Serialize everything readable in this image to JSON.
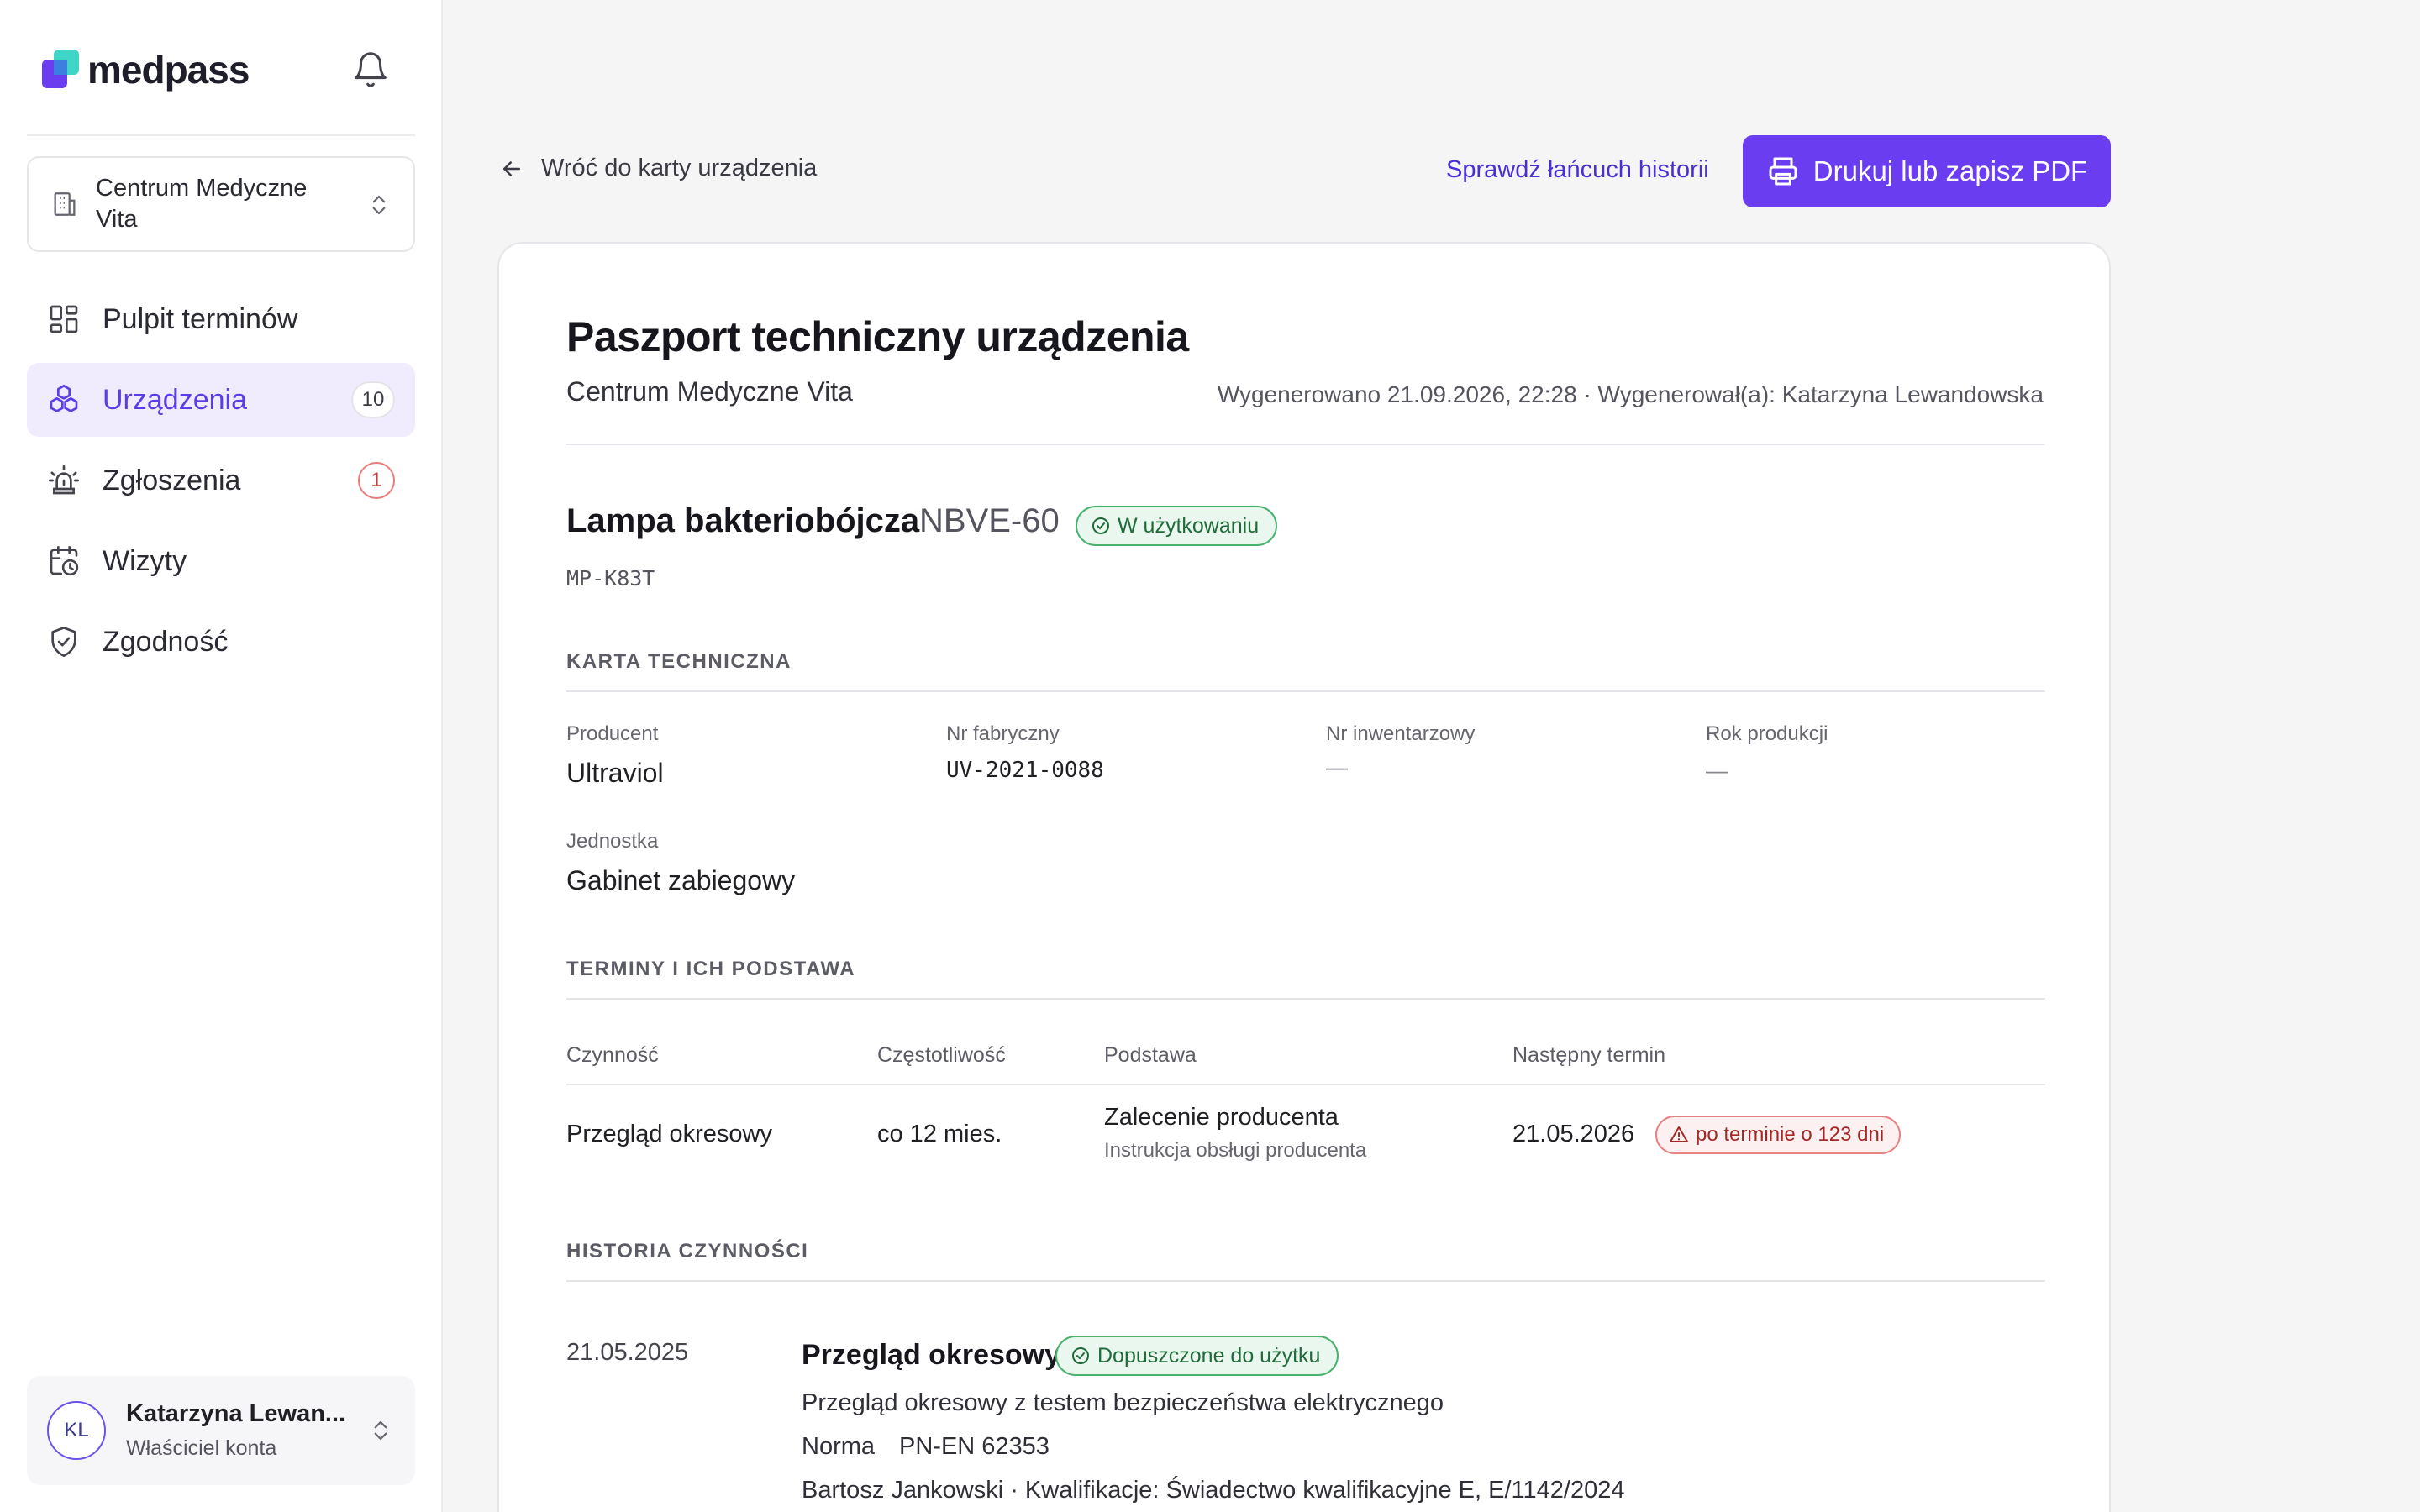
{
  "brand": {
    "name": "medpass",
    "accent": "#6a3df0"
  },
  "sidebar": {
    "org": "Centrum Medyczne Vita",
    "items": [
      {
        "label": "Pulpit terminów",
        "icon": "dashboard-icon",
        "badge": ""
      },
      {
        "label": "Urządzenia",
        "icon": "devices-icon",
        "badge": "10"
      },
      {
        "label": "Zgłoszenia",
        "icon": "alarm-icon",
        "badge": "1"
      },
      {
        "label": "Wizyty",
        "icon": "calendar-clock-icon",
        "badge": ""
      },
      {
        "label": "Zgodność",
        "icon": "shield-check-icon",
        "badge": ""
      }
    ],
    "user": {
      "initials": "KL",
      "name": "Katarzyna Lewan...",
      "role": "Właściciel konta"
    }
  },
  "toolbar": {
    "back_label": "Wróć do karty urządzenia",
    "history_label": "Sprawdź łańcuch historii",
    "print_label": "Drukuj lub zapisz PDF"
  },
  "doc": {
    "title": "Paszport techniczny urządzenia",
    "org": "Centrum Medyczne Vita",
    "meta": "Wygenerowano 21.09.2026, 22:28 · Wygenerował(a): Katarzyna Lewandowska",
    "device": {
      "name": "Lampa bakteriobójcza",
      "model": "NBVE-60",
      "status": "W użytkowaniu",
      "code": "MP-K83T"
    },
    "tech": {
      "heading": "KARTA TECHNICZNA",
      "producer_label": "Producent",
      "producer": "Ultraviol",
      "serial_label": "Nr fabryczny",
      "serial": "UV-2021-0088",
      "inventory_label": "Nr inwentarzowy",
      "inventory": "—",
      "year_label": "Rok produkcji",
      "year": "—",
      "unit_label": "Jednostka",
      "unit": "Gabinet zabiegowy"
    },
    "terms": {
      "heading": "TERMINY I ICH PODSTAWA",
      "columns": [
        "Czynność",
        "Częstotliwość",
        "Podstawa",
        "Następny termin"
      ],
      "rows": [
        {
          "action": "Przegląd okresowy",
          "frequency": "co 12 mies.",
          "basis": "Zalecenie producenta",
          "basis_note": "Instrukcja obsługi producenta",
          "next": "21.05.2026",
          "overdue": "po terminie o 123 dni"
        }
      ]
    },
    "history": {
      "heading": "HISTORIA CZYNNOŚCI",
      "entries": [
        {
          "date": "21.05.2025",
          "title": "Przegląd okresowy",
          "status": "Dopuszczone do użytku",
          "description": "Przegląd okresowy z testem bezpieczeństwa elektrycznego",
          "norm_label": "Norma",
          "norm": "PN-EN 62353",
          "performer": "Bartosz Jankowski · Kwalifikacje: Świadectwo kwalifikacyjne E, E/1142/2024"
        }
      ]
    }
  }
}
